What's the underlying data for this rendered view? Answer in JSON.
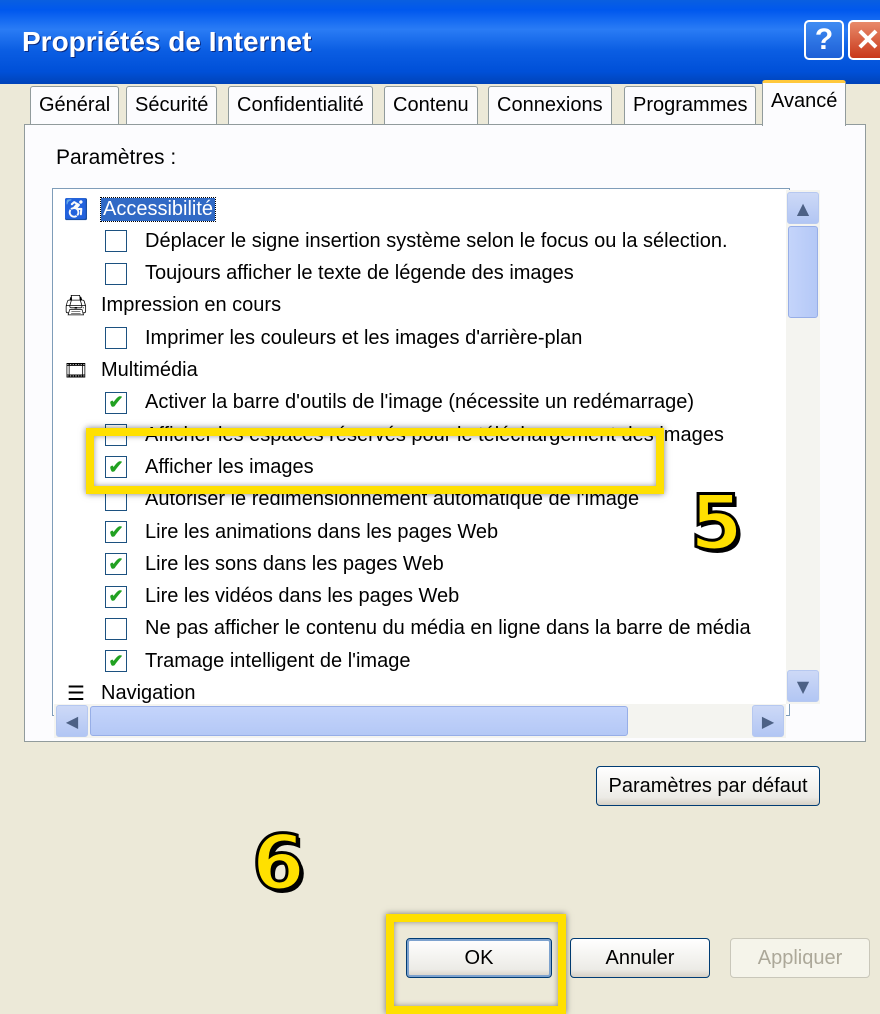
{
  "window": {
    "title": "Propriétés de Internet",
    "help_glyph": "?",
    "close_glyph": "✕"
  },
  "tabs": [
    "Général",
    "Sécurité",
    "Confidentialité",
    "Contenu",
    "Connexions",
    "Programmes",
    "Avancé"
  ],
  "active_tab": "Avancé",
  "settings_label": "Paramètres :",
  "tree": {
    "rows": [
      {
        "type": "category",
        "icon": "accessibility-icon",
        "label": "Accessibilité",
        "selected": true
      },
      {
        "type": "option",
        "checked": false,
        "label": "Déplacer le signe insertion système selon le focus ou la sélection."
      },
      {
        "type": "option",
        "checked": false,
        "label": "Toujours afficher le texte de légende des images"
      },
      {
        "type": "category",
        "icon": "printer-icon",
        "label": "Impression en cours"
      },
      {
        "type": "option",
        "checked": false,
        "label": "Imprimer les couleurs et les images d'arrière-plan"
      },
      {
        "type": "category",
        "icon": "multimedia-icon",
        "label": "Multimédia"
      },
      {
        "type": "option",
        "checked": true,
        "label": "Activer la barre d'outils de l'image (nécessite un redémarrage)"
      },
      {
        "type": "option",
        "checked": false,
        "label": "Afficher les espaces réservés pour le téléchargement des images"
      },
      {
        "type": "option",
        "checked": true,
        "label": "Afficher les images"
      },
      {
        "type": "option",
        "checked": false,
        "label": "Autoriser le redimensionnement automatique de l'image"
      },
      {
        "type": "option",
        "checked": true,
        "label": "Lire les animations dans les pages Web"
      },
      {
        "type": "option",
        "checked": true,
        "label": "Lire les sons dans les pages Web"
      },
      {
        "type": "option",
        "checked": true,
        "label": "Lire les vidéos dans les pages Web"
      },
      {
        "type": "option",
        "checked": false,
        "label": "Ne pas afficher le contenu du média en ligne dans la barre de média"
      },
      {
        "type": "option",
        "checked": true,
        "label": "Tramage intelligent de l'image"
      },
      {
        "type": "category",
        "icon": "navigation-icon",
        "label": "Navigation"
      }
    ]
  },
  "buttons": {
    "restore_defaults": "Paramètres par défaut",
    "ok": "OK",
    "cancel": "Annuler",
    "apply": "Appliquer"
  },
  "annotations": {
    "step5": "5",
    "step6": "6"
  },
  "colors": {
    "highlight": "#ffe000",
    "titlebar": "#0058ee",
    "checkmark": "#21a121"
  }
}
